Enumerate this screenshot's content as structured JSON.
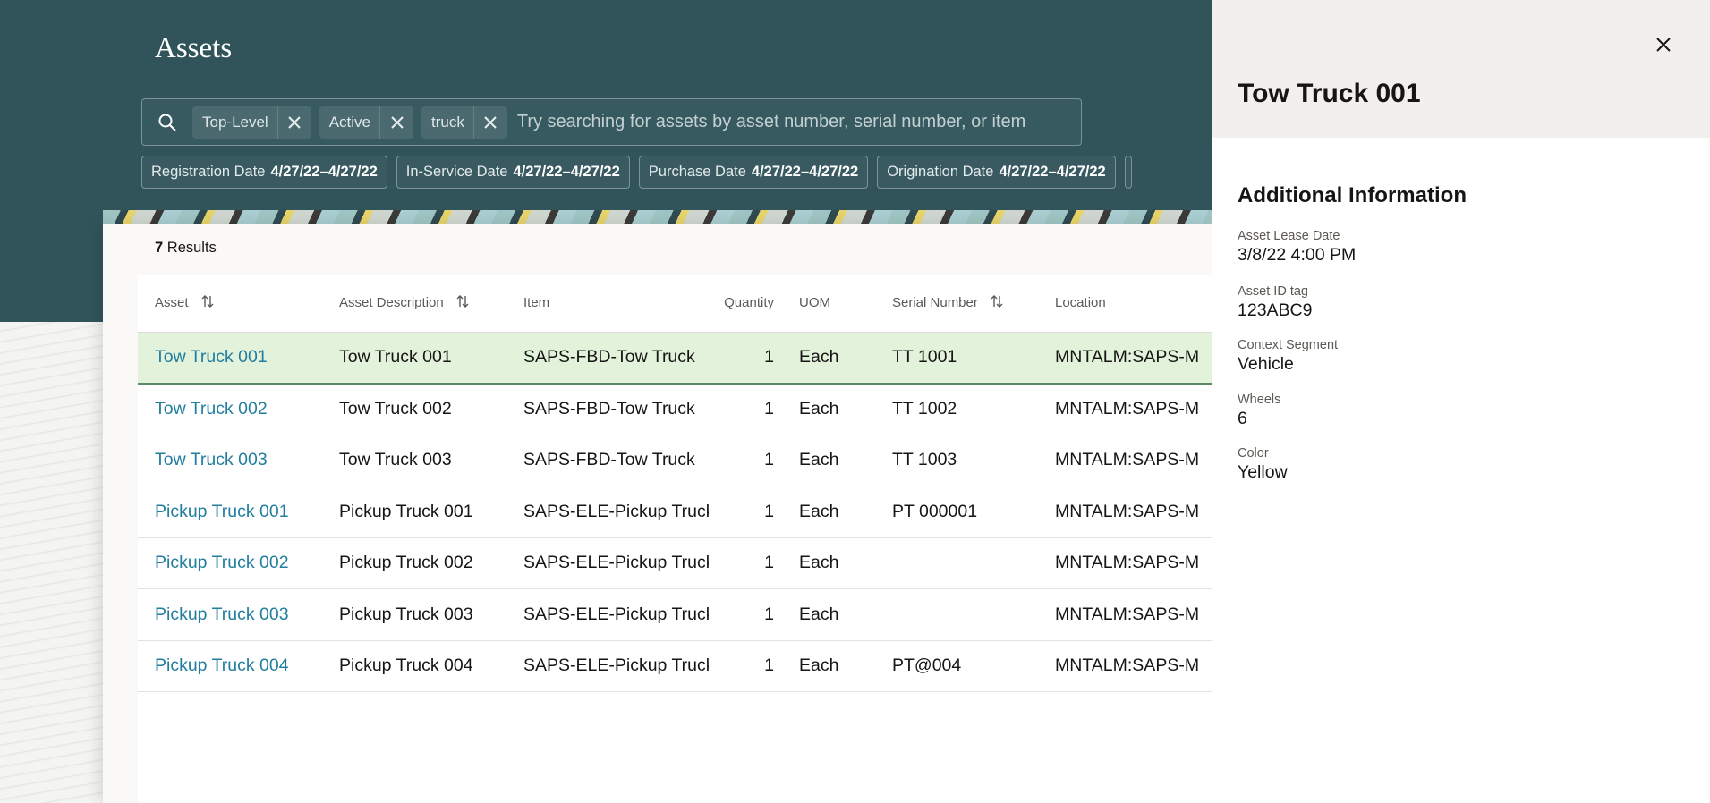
{
  "page": {
    "title": "Assets"
  },
  "search": {
    "chips": [
      "Top-Level",
      "Active",
      "truck"
    ],
    "placeholder": "Try searching for assets by asset number, serial number, or item"
  },
  "date_filters": [
    {
      "label": "Registration Date",
      "value": "4/27/22–4/27/22"
    },
    {
      "label": "In-Service Date",
      "value": "4/27/22–4/27/22"
    },
    {
      "label": "Purchase Date",
      "value": "4/27/22–4/27/22"
    },
    {
      "label": "Origination Date",
      "value": "4/27/22–4/27/22"
    }
  ],
  "results": {
    "count": "7",
    "label": "Results"
  },
  "table": {
    "columns": [
      "Asset",
      "Asset Description",
      "Item",
      "Quantity",
      "UOM",
      "Serial Number",
      "Location"
    ],
    "rows": [
      [
        "Tow Truck 001",
        "Tow Truck 001",
        "SAPS-FBD-Tow Truck",
        "1",
        "Each",
        "TT 1001",
        "MNTALM:SAPS-M"
      ],
      [
        "Tow Truck 002",
        "Tow Truck 002",
        "SAPS-FBD-Tow Truck",
        "1",
        "Each",
        "TT 1002",
        "MNTALM:SAPS-M"
      ],
      [
        "Tow Truck 003",
        "Tow Truck 003",
        "SAPS-FBD-Tow Truck",
        "1",
        "Each",
        "TT 1003",
        "MNTALM:SAPS-M"
      ],
      [
        "Pickup Truck 001",
        "Pickup Truck 001",
        "SAPS-ELE-Pickup Truck",
        "1",
        "Each",
        "PT 000001",
        "MNTALM:SAPS-M"
      ],
      [
        "Pickup Truck 002",
        "Pickup Truck 002",
        "SAPS-ELE-Pickup Truck",
        "1",
        "Each",
        "",
        "MNTALM:SAPS-M"
      ],
      [
        "Pickup Truck 003",
        "Pickup Truck 003",
        "SAPS-ELE-Pickup Truck",
        "1",
        "Each",
        "",
        "MNTALM:SAPS-M"
      ],
      [
        "Pickup Truck 004",
        "Pickup Truck 004",
        "SAPS-ELE-Pickup Truck",
        "1",
        "Each",
        "PT@004",
        "MNTALM:SAPS-M"
      ]
    ],
    "selected_row": 0
  },
  "drawer": {
    "title": "Tow Truck 001",
    "section_title": "Additional Information",
    "fields": [
      {
        "label": "Asset Lease Date",
        "value": "3/8/22 4:00 PM"
      },
      {
        "label": "Asset ID tag",
        "value": "123ABC9"
      },
      {
        "label": "Context Segment",
        "value": "Vehicle"
      },
      {
        "label": "Wheels",
        "value": "6"
      },
      {
        "label": "Color",
        "value": "Yellow"
      }
    ]
  },
  "colors": {
    "header": "#31545b",
    "link": "#227e9e",
    "selected_row": "#e2f2db"
  }
}
